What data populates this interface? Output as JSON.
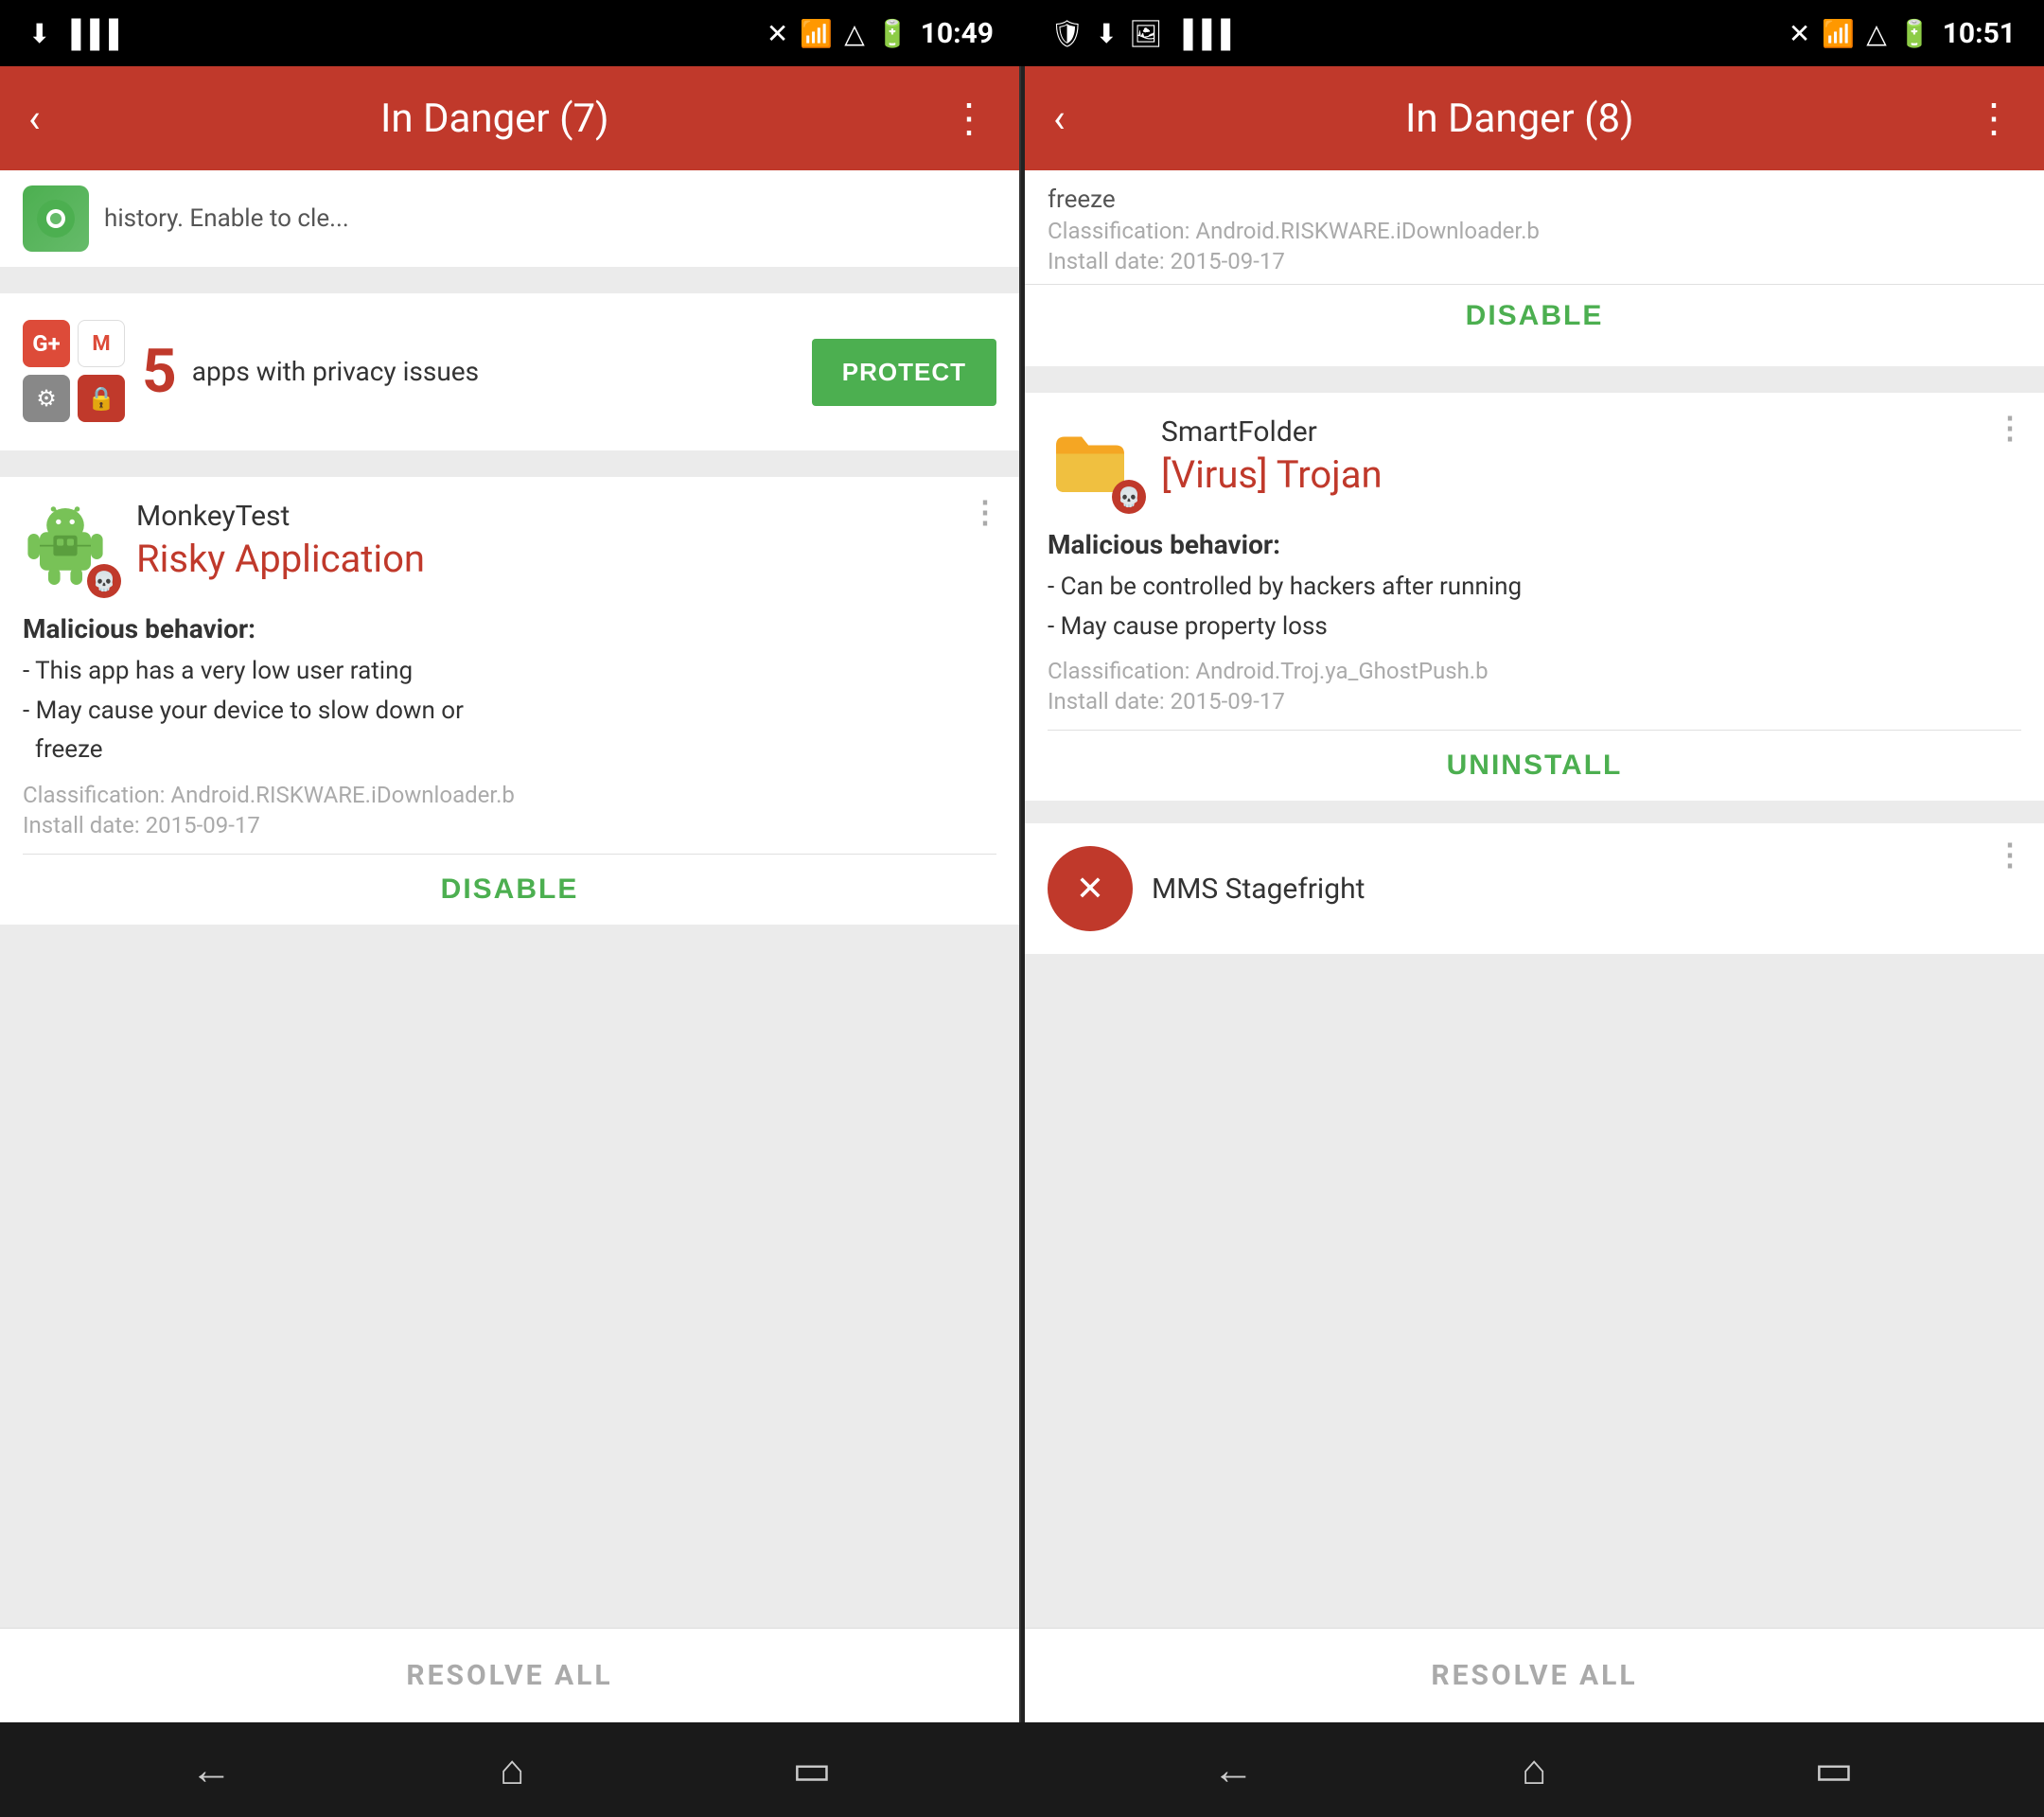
{
  "left_panel": {
    "status_bar": {
      "time": "10:49",
      "icons_left": [
        "notifications",
        "bars"
      ]
    },
    "toolbar": {
      "title": "In Danger (7)",
      "back_label": "‹",
      "more_label": "⋮"
    },
    "top_card": {
      "icon_color": "#4CAF50",
      "text": "history. Enable to cle..."
    },
    "privacy_card": {
      "count": "5",
      "text": "apps with privacy\nissues",
      "protect_label": "PROTECT"
    },
    "monkey_card": {
      "app_name": "MonkeyTest",
      "threat_label": "Risky Application",
      "malicious_header": "Malicious behavior:",
      "malicious_items": [
        "- This app has a very low user rating",
        "- May cause your device to slow down or\n  freeze"
      ],
      "classification": "Classification: Android.RISKWARE.iDownloader.b",
      "install_date": "Install date: 2015-09-17",
      "action_label": "DISABLE"
    },
    "resolve_all_label": "RESOLVE ALL"
  },
  "right_panel": {
    "status_bar": {
      "time": "10:51",
      "icons_left": [
        "notifications",
        "bars"
      ]
    },
    "toolbar": {
      "title": "In Danger (8)",
      "back_label": "‹",
      "more_label": "⋮"
    },
    "top_partial": {
      "freeze_text": "freeze",
      "classification": "Classification: Android.RISKWARE.iDownloader.b",
      "install_date": "Install date: 2015-09-17",
      "action_label": "DISABLE"
    },
    "smartfolder_card": {
      "app_name": "SmartFolder",
      "threat_label": "[Virus] Trojan",
      "malicious_header": "Malicious behavior:",
      "malicious_items": [
        "- Can be controlled by hackers after running",
        "- May cause property loss"
      ],
      "classification": "Classification: Android.Troj.ya_GhostPush.b",
      "install_date": "Install date: 2015-09-17",
      "action_label": "UNINSTALL"
    },
    "mms_partial": {
      "title": "MMS Stagefright"
    },
    "resolve_all_label": "RESOLVE ALL"
  },
  "bottom_nav": {
    "back_icon": "←",
    "home_icon": "⌂",
    "recents_icon": "▭"
  },
  "colors": {
    "header_red": "#c0392b",
    "threat_red": "#c0392b",
    "action_green": "#4CAF50",
    "protect_green": "#4CAF50",
    "text_dark": "#333333",
    "text_gray": "#aaaaaa"
  }
}
